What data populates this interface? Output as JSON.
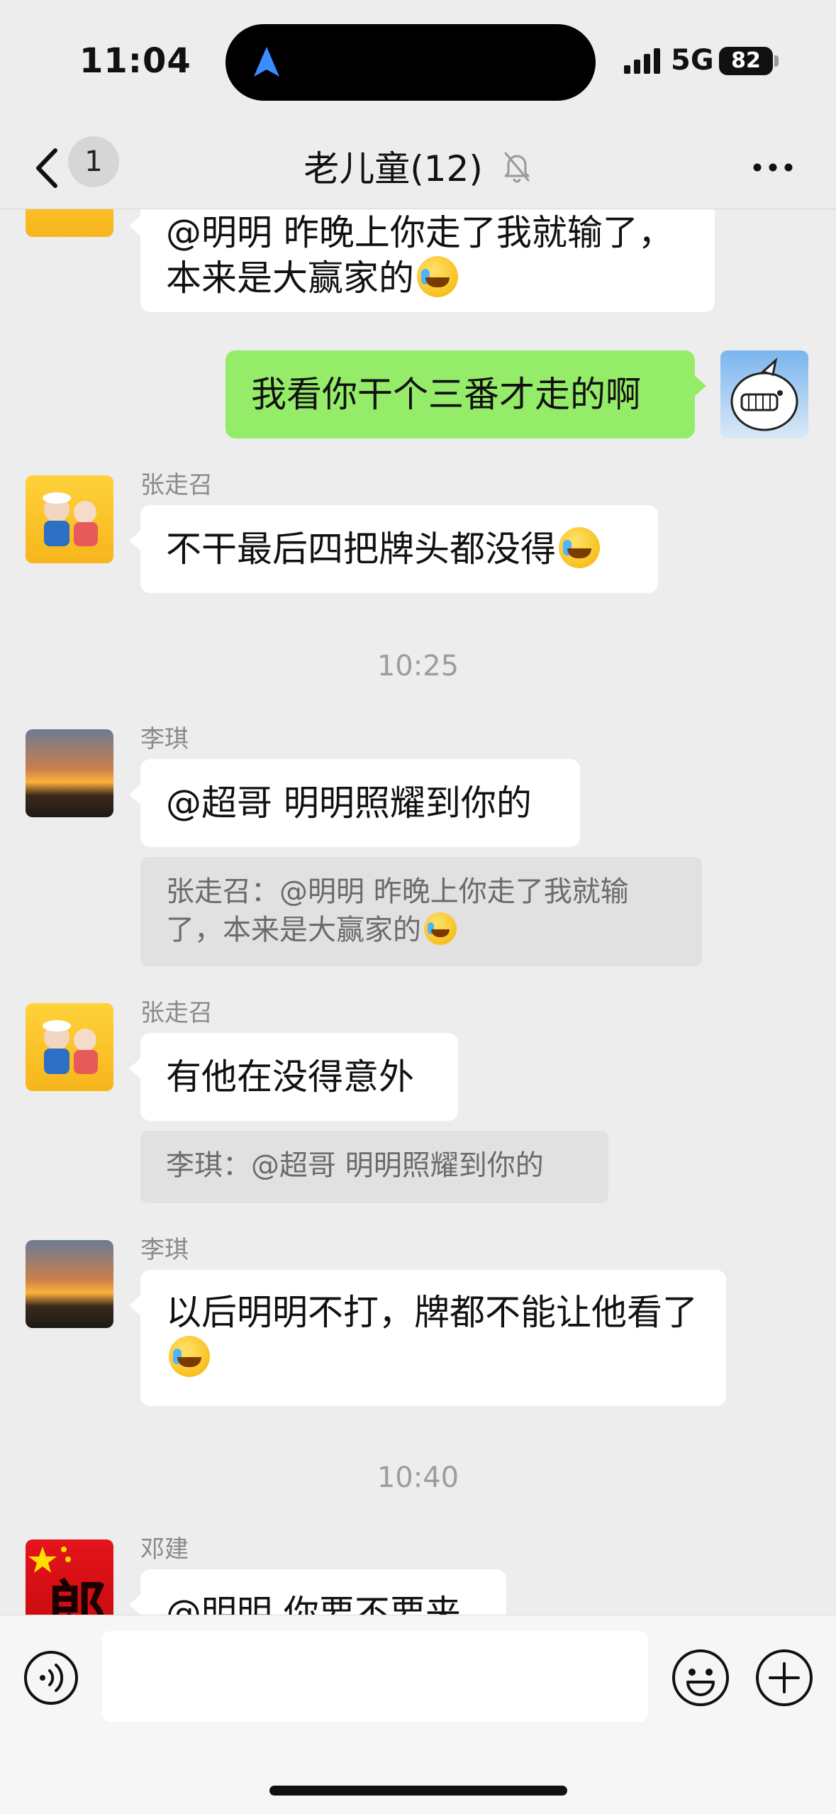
{
  "status_bar": {
    "time": "11:04",
    "network": "5G",
    "battery": "82"
  },
  "header": {
    "back_count": "1",
    "title": "老儿童(12)"
  },
  "messages": [
    {
      "sender": "",
      "text": "@明明 昨晚上你走了我就输了，本来是大赢家的",
      "emoji": "😭"
    },
    {
      "sender": "me",
      "text": "我看你干个三番才走的啊"
    },
    {
      "sender": "张走召",
      "text": "不干最后四把牌头都没得",
      "emoji": "😭"
    },
    {
      "sender": "李琪",
      "text": "@超哥 明明照耀到你的",
      "quote": "张走召：@明明 昨晚上你走了我就输了，本来是大赢家的",
      "quote_emoji": "😭"
    },
    {
      "sender": "张走召",
      "text": "有他在没得意外",
      "quote": "李琪：@超哥 明明照耀到你的"
    },
    {
      "sender": "李琪",
      "text": "以后明明不打，牌都不能让他看了",
      "emoji": "😭"
    },
    {
      "sender": "邓建",
      "text": "@明明 你要不要来"
    }
  ],
  "timestamps": [
    "10:25",
    "10:40"
  ],
  "avatars": {
    "flag_char": "郎"
  },
  "colors": {
    "sent_bubble": "#95ec69",
    "received_bubble": "#ffffff",
    "background": "#ededed"
  }
}
